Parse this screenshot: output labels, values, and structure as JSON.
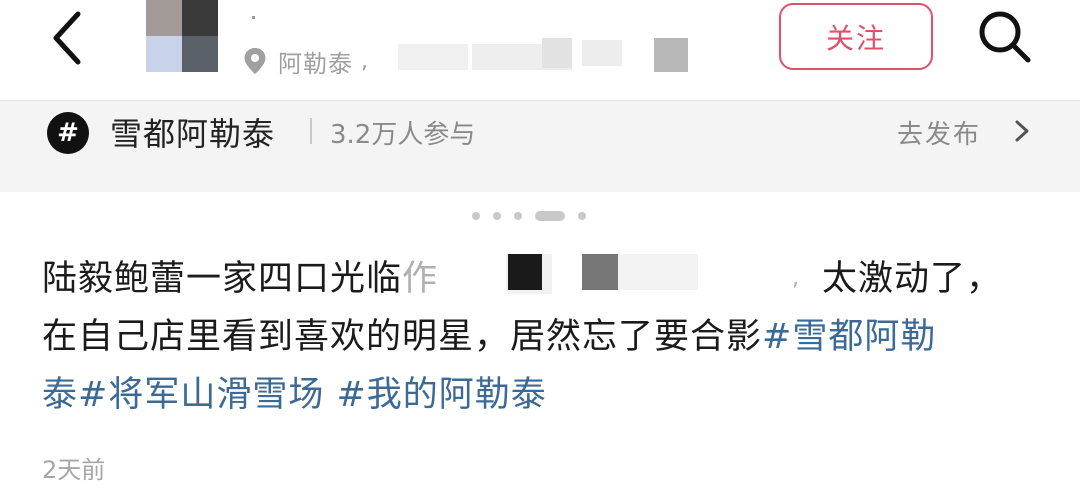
{
  "header": {
    "location": "阿勒泰",
    "location_comma": ",",
    "follow_label": "关注"
  },
  "topic": {
    "name": "雪都阿勒泰",
    "participants": "3.2万人参与",
    "go_post": "去发布"
  },
  "carousel": {
    "count": 5,
    "active_index": 3
  },
  "post": {
    "line1_text": "陆毅鲍蕾一家四口光临",
    "line1_partial": "作",
    "line1_tail": "太激动了，",
    "line1_comma": ",",
    "line2_text": "在自己店里看到喜欢的明星，居然忘了要合影",
    "line2_tag": "#雪都阿勒",
    "line3_tag1": "泰#将军山滑雪场",
    "line3_tag2": "#我的阿勒泰"
  },
  "timestamp": "2天前",
  "colors": {
    "accent": "#e0506a",
    "tag": "#3c6a96",
    "muted": "#8a8a8a"
  },
  "icons": [
    "back-arrow-icon",
    "location-pin-icon",
    "search-icon",
    "hashtag-icon",
    "chevron-right-icon"
  ]
}
